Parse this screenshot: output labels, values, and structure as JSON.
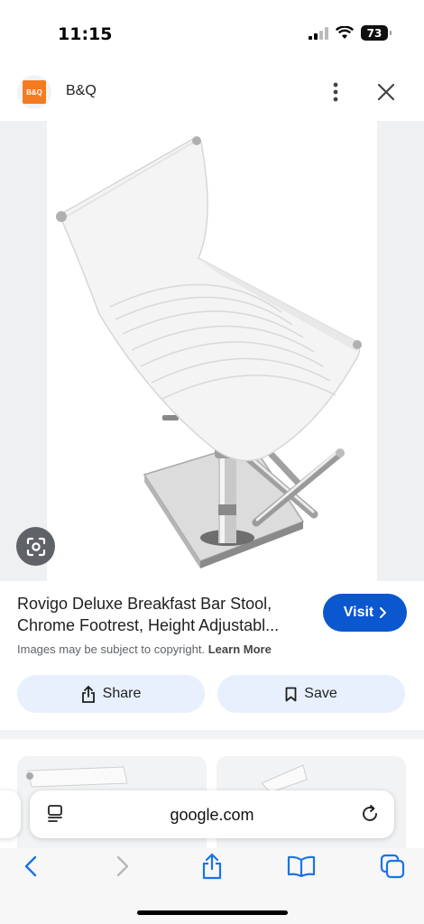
{
  "status_bar": {
    "time": "11:15",
    "battery": "73"
  },
  "header": {
    "site_name": "B&Q",
    "favicon_text": "B&Q"
  },
  "product": {
    "title_line1": "Rovigo Deluxe Breakfast Bar Stool,",
    "title_line2": "Chrome Footrest, Height Adjustabl...",
    "copyright_text": "Images may be subject to copyright.",
    "learn_more": "Learn More"
  },
  "actions": {
    "visit_label": "Visit",
    "share_label": "Share",
    "save_label": "Save"
  },
  "browser": {
    "url": "google.com"
  },
  "icons": {
    "more": "more-vert-icon",
    "close": "close-icon",
    "lens": "google-lens-icon",
    "share": "share-icon",
    "save": "bookmark-icon",
    "reader": "reader-icon",
    "reload": "reload-icon",
    "back": "back-icon",
    "forward": "forward-icon",
    "browser_share": "share-icon",
    "bookmarks": "book-icon",
    "tabs": "tabs-icon"
  },
  "colors": {
    "accent": "#0b57d0",
    "action_bg": "#e8f0fe",
    "brand": "#f47b20",
    "safari_blue": "#1a73e8"
  }
}
